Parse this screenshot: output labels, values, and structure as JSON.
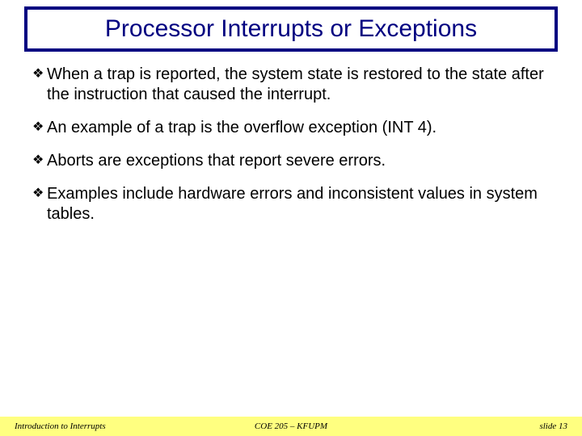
{
  "title": "Processor Interrupts or Exceptions",
  "bullets": [
    "When a trap is reported, the system state is restored to the state after the instruction that caused the interrupt.",
    "An example of a trap is the overflow exception (INT 4).",
    "Aborts are exceptions that report severe errors.",
    "Examples include hardware errors and inconsistent values in system tables."
  ],
  "bullet_glyph": "❖",
  "footer": {
    "left": "Introduction to Interrupts",
    "center": "COE 205 – KFUPM",
    "right": "slide 13"
  }
}
